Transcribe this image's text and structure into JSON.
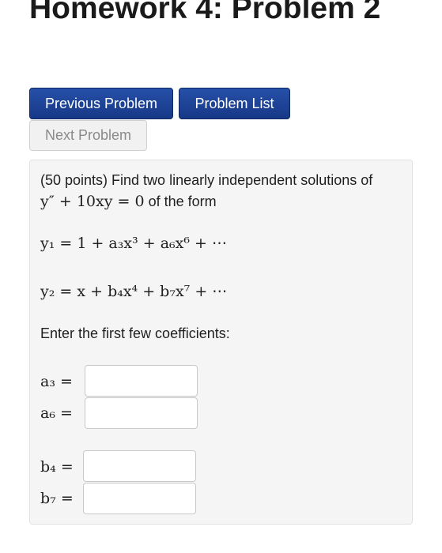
{
  "page": {
    "title": "Homework 4: Problem 2"
  },
  "nav": {
    "previous_label": "Previous Problem",
    "list_label": "Problem List",
    "next_label": "Next Problem"
  },
  "problem": {
    "intro_text": "(50 points) Find two linearly independent solutions of",
    "equation": "y″ + 10xy = 0",
    "intro_suffix": "of the form",
    "y1_expression": "y₁ = 1 + a₃x³ + a₆x⁶ + ⋯",
    "y2_expression": "y₂ = x + b₄x⁴ + b₇x⁷ + ⋯",
    "prompt": "Enter the first few coefficients:"
  },
  "answers": [
    {
      "label": "a₃ =",
      "value": ""
    },
    {
      "label": "a₆ =",
      "value": ""
    },
    {
      "label": "b₄ =",
      "value": ""
    },
    {
      "label": "b₇ =",
      "value": ""
    }
  ],
  "colors": {
    "primary_button": "#1c3f94",
    "disabled_button": "#f1f1f1",
    "problem_background": "#f5f5f5"
  }
}
